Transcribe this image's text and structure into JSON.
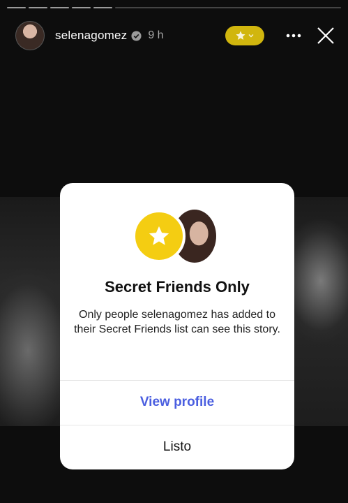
{
  "header": {
    "username": "selenagomez",
    "time": "9 h"
  },
  "modal": {
    "title": "Secret Friends Only",
    "description": "Only people selenagomez has added to their Secret Friends list can see this story.",
    "view_profile": "View profile",
    "done": "Listo"
  },
  "colors": {
    "accent_yellow": "#f4cd12",
    "link_blue": "#4a5ee0",
    "pill_yellow": "#d1b60e"
  },
  "icons": [
    "verified-icon",
    "star-icon",
    "chevron-down-icon",
    "more-icon",
    "close-icon"
  ]
}
